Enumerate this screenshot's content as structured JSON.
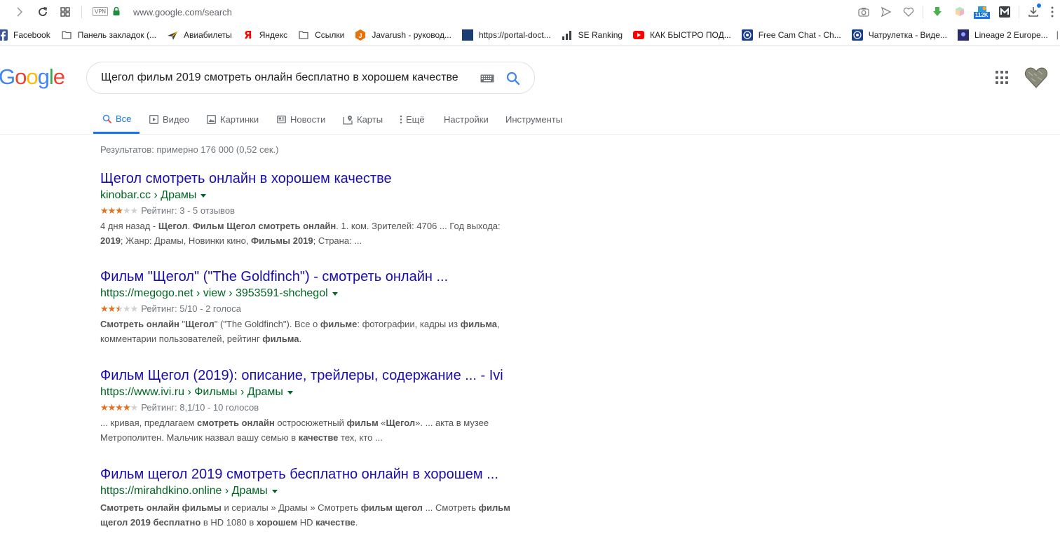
{
  "browser": {
    "url_host": "www.google.com",
    "url_path": "/search",
    "vpn_label": "VPN",
    "extension_badge": "112K"
  },
  "bookmarks": [
    {
      "label": "Facebook",
      "icon": "facebook-icon",
      "color": "#3b5998"
    },
    {
      "label": "Панель закладок (...",
      "icon": "folder-icon",
      "color": "#5f6368"
    },
    {
      "label": "Авиабилеты",
      "icon": "airplane-icon",
      "color": "#f4b400"
    },
    {
      "label": "Яндекс",
      "icon": "yandex-icon",
      "color": "#ff0000"
    },
    {
      "label": "Ссылки",
      "icon": "folder-icon",
      "color": "#5f6368"
    },
    {
      "label": "Javarush - руковод...",
      "icon": "javarush-icon",
      "color": "#e8710a"
    },
    {
      "label": "https://portal-doct...",
      "icon": "portal-icon",
      "color": "#1a3e72"
    },
    {
      "label": "SE Ranking",
      "icon": "bars-icon",
      "color": "#3c4043"
    },
    {
      "label": "КАК БЫСТРО ПОД...",
      "icon": "youtube-icon",
      "color": "#ff0000"
    },
    {
      "label": "Free Cam Chat - Ch...",
      "icon": "chat-icon",
      "color": "#1a3e8c"
    },
    {
      "label": "Чатрулетка - Виде...",
      "icon": "chat-icon",
      "color": "#1a3e8c"
    },
    {
      "label": "Lineage 2 Europe...",
      "icon": "lineage-icon",
      "color": "#2b2b6b"
    }
  ],
  "search": {
    "query": "Щегол фильм 2019 смотреть онлайн бесплатно в хорошем качестве"
  },
  "tabs": [
    {
      "label": "Все",
      "icon": "search-icon",
      "active": true
    },
    {
      "label": "Видео",
      "icon": "video-icon"
    },
    {
      "label": "Картинки",
      "icon": "image-icon"
    },
    {
      "label": "Новости",
      "icon": "news-icon"
    },
    {
      "label": "Карты",
      "icon": "map-icon"
    },
    {
      "label": "Ещё",
      "icon": "more-vert-icon"
    },
    {
      "label": "Настройки"
    },
    {
      "label": "Инструменты"
    }
  ],
  "stats": "Результатов: примерно 176 000 (0,52 сек.) ",
  "results": [
    {
      "title": "Щегол смотреть онлайн в хорошем качестве",
      "url": "kinobar.cc › Драмы",
      "rating_stars": 3,
      "rating_text": "Рейтинг: 3 - 5 отзывов",
      "snippet_html": "4 дня назад - <b>Щегол</b>. <b>Фильм Щегол смотреть онлайн</b>. 1. ком. Зрителей: 4706 ... Год выхода: <b>2019</b>; Жанр: Драмы, Новинки кино, <b>Фильмы 2019</b>; Страна: ..."
    },
    {
      "title": "Фильм \"Щегол\" (\"The Goldfinch\") - смотреть онлайн ...",
      "url": "https://megogo.net › view › 3953591-shchegol",
      "rating_stars": 2.5,
      "rating_text": "Рейтинг: 5/10 - 2 голоса",
      "snippet_html": "<b>Смотреть онлайн</b> \"<b>Щегол</b>\" (\"The Goldfinch\"). Все о <b>фильме</b>: фотографии, кадры из <b>фильма</b>, комментарии пользователей, рейтинг <b>фильма</b>."
    },
    {
      "title": "Фильм Щегол (2019): описание, трейлеры, содержание ... - Ivi",
      "url": "https://www.ivi.ru › Фильмы › Драмы",
      "rating_stars": 4,
      "rating_text": "Рейтинг: 8,1/10 - 10 голосов",
      "snippet_html": "... кривая, предлагаем <b>смотреть онлайн</b> остросюжетный <b>фильм</b> «<b>Щегол</b>». ... акта в музее Метрополитен. Мальчик назвал вашу семью в <b>качестве</b> тех, кто ..."
    },
    {
      "title": "Фильм щегол 2019 смотреть бесплатно онлайн в хорошем ...",
      "url": "https://mirahdkino.online › Драмы",
      "rating_stars": null,
      "rating_text": "",
      "snippet_html": "<b>Смотреть онлайн фильмы</b> и сериалы » Драмы » Смотреть <b>фильм щегол</b> ... Смотреть <b>фильм щегол 2019 бесплатно</b> в HD 1080 в <b>хорошем</b> HD <b>качестве</b>."
    }
  ],
  "colors": {
    "link": "#1a0dab",
    "url_green": "#006621",
    "accent": "#1a73e8",
    "star": "#e7711b"
  }
}
